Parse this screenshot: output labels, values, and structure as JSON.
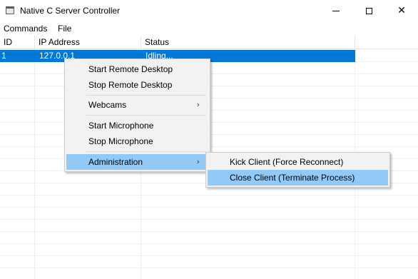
{
  "window": {
    "title": "Native C Server Controller",
    "icon": "window-app-icon",
    "caption_buttons": {
      "minimize_icon": "minimize-icon",
      "maximize_icon": "maximize-icon",
      "close_icon": "close-icon",
      "close_glyph": "✕"
    }
  },
  "menubar": {
    "commands_label": "Commands",
    "file_label": "File"
  },
  "list": {
    "columns": {
      "id": "ID",
      "ip": "IP Address",
      "status": "Status"
    },
    "rows": [
      {
        "id": "1",
        "ip": "127.0.0.1",
        "status": "Idling..."
      }
    ],
    "selected_row_color": "#0078d7"
  },
  "context_menu": {
    "items": [
      {
        "label": "Start Remote Desktop"
      },
      {
        "label": "Stop Remote Desktop"
      },
      {
        "label": "Webcams",
        "arrow": "›"
      },
      {
        "label": "Start Microphone"
      },
      {
        "label": "Stop Microphone"
      },
      {
        "label": "Administration",
        "arrow": "›"
      }
    ],
    "highlight_color": "#91c9f7"
  },
  "submenu_administration": {
    "items": [
      {
        "label": "Kick Client (Force Reconnect)"
      },
      {
        "label": "Close Client (Terminate Process)"
      }
    ]
  }
}
